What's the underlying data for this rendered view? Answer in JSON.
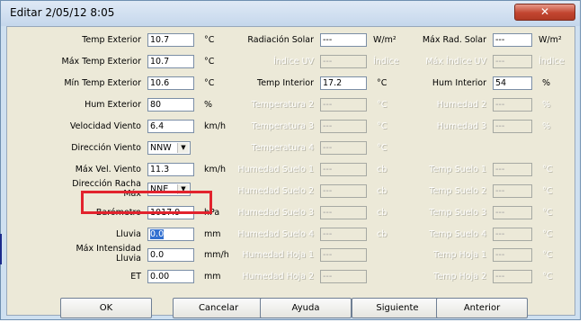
{
  "window": {
    "title": "Editar 2/05/12 8:05",
    "close_glyph": "✕"
  },
  "fields": {
    "temp_exterior": {
      "label": "Temp Exterior",
      "value": "10.7",
      "unit": "°C"
    },
    "max_temp_exterior": {
      "label": "Máx Temp Exterior",
      "value": "10.7",
      "unit": "°C"
    },
    "min_temp_exterior": {
      "label": "Mín Temp Exterior",
      "value": "10.6",
      "unit": "°C"
    },
    "hum_exterior": {
      "label": "Hum Exterior",
      "value": "80",
      "unit": "%"
    },
    "velocidad_viento": {
      "label": "Velocidad Viento",
      "value": "6.4",
      "unit": "km/h"
    },
    "direccion_viento": {
      "label": "Dirección Viento",
      "value": "NNW"
    },
    "max_vel_viento": {
      "label": "Máx Vel. Viento",
      "value": "11.3",
      "unit": "km/h"
    },
    "direccion_racha_max": {
      "label_line1": "Dirección Racha",
      "label_line2": "Máx",
      "value": "NNE"
    },
    "barometro": {
      "label": "Barómetro",
      "value": "1017.9",
      "unit": "hPa"
    },
    "lluvia": {
      "label": "Lluvia",
      "value": "0.0",
      "unit": "mm"
    },
    "max_intensidad_lluvia": {
      "label_line1": "Máx Intensidad",
      "label_line2": "Lluvia",
      "value": "0.0",
      "unit": "mm/h"
    },
    "et": {
      "label": "ET",
      "value": "0.00",
      "unit": "mm"
    },
    "radiacion_solar": {
      "label": "Radiación Solar",
      "value": "---",
      "unit": "W/m²"
    },
    "indice_uv": {
      "label": "Índice UV",
      "value": "---",
      "unit": "Índice"
    },
    "temp_interior": {
      "label": "Temp Interior",
      "value": "17.2",
      "unit": "°C"
    },
    "temperatura_2": {
      "label": "Temperatura 2",
      "value": "---",
      "unit": "°C"
    },
    "temperatura_3": {
      "label": "Temperatura 3",
      "value": "---",
      "unit": "°C"
    },
    "temperatura_4": {
      "label": "Temperatura 4",
      "value": "---",
      "unit": "°C"
    },
    "humedad_suelo_1": {
      "label": "Humedad Suelo 1",
      "value": "---",
      "unit": "cb"
    },
    "humedad_suelo_2": {
      "label": "Humedad Suelo 2",
      "value": "---",
      "unit": "cb"
    },
    "humedad_suelo_3": {
      "label": "Humedad Suelo 3",
      "value": "---",
      "unit": "cb"
    },
    "humedad_suelo_4": {
      "label": "Humedad Suelo 4",
      "value": "---",
      "unit": "cb"
    },
    "humedad_hoja_1": {
      "label": "Humedad Hoja 1",
      "value": "---"
    },
    "humedad_hoja_2": {
      "label": "Humedad Hoja 2",
      "value": "---"
    },
    "max_rad_solar": {
      "label": "Máx Rad. Solar",
      "value": "---",
      "unit": "W/m²"
    },
    "max_indice_uv": {
      "label": "Máx Índice UV",
      "value": "---",
      "unit": "Índice"
    },
    "hum_interior": {
      "label": "Hum Interior",
      "value": "54",
      "unit": "%"
    },
    "humedad_2": {
      "label": "Humedad 2",
      "value": "---",
      "unit": "%"
    },
    "humedad_3": {
      "label": "Humedad 3",
      "value": "---",
      "unit": "%"
    },
    "temp_suelo_1": {
      "label": "Temp Suelo 1",
      "value": "---",
      "unit": "°C"
    },
    "temp_suelo_2": {
      "label": "Temp Suelo 2",
      "value": "---",
      "unit": "°C"
    },
    "temp_suelo_3": {
      "label": "Temp Suelo 3",
      "value": "---",
      "unit": "°C"
    },
    "temp_suelo_4": {
      "label": "Temp Suelo 4",
      "value": "---",
      "unit": "°C"
    },
    "temp_hoja_1": {
      "label": "Temp Hoja 1",
      "value": "---",
      "unit": "°C"
    },
    "temp_hoja_2": {
      "label": "Temp Hoja 2",
      "value": "---",
      "unit": "°C"
    }
  },
  "buttons": {
    "ok": "OK",
    "cancelar": "Cancelar",
    "ayuda": "Ayuda",
    "siguiente": "Siguiente",
    "anterior": "Anterior"
  },
  "colors": {
    "highlight_box": "#e2232d",
    "selection": "#3270d0"
  }
}
